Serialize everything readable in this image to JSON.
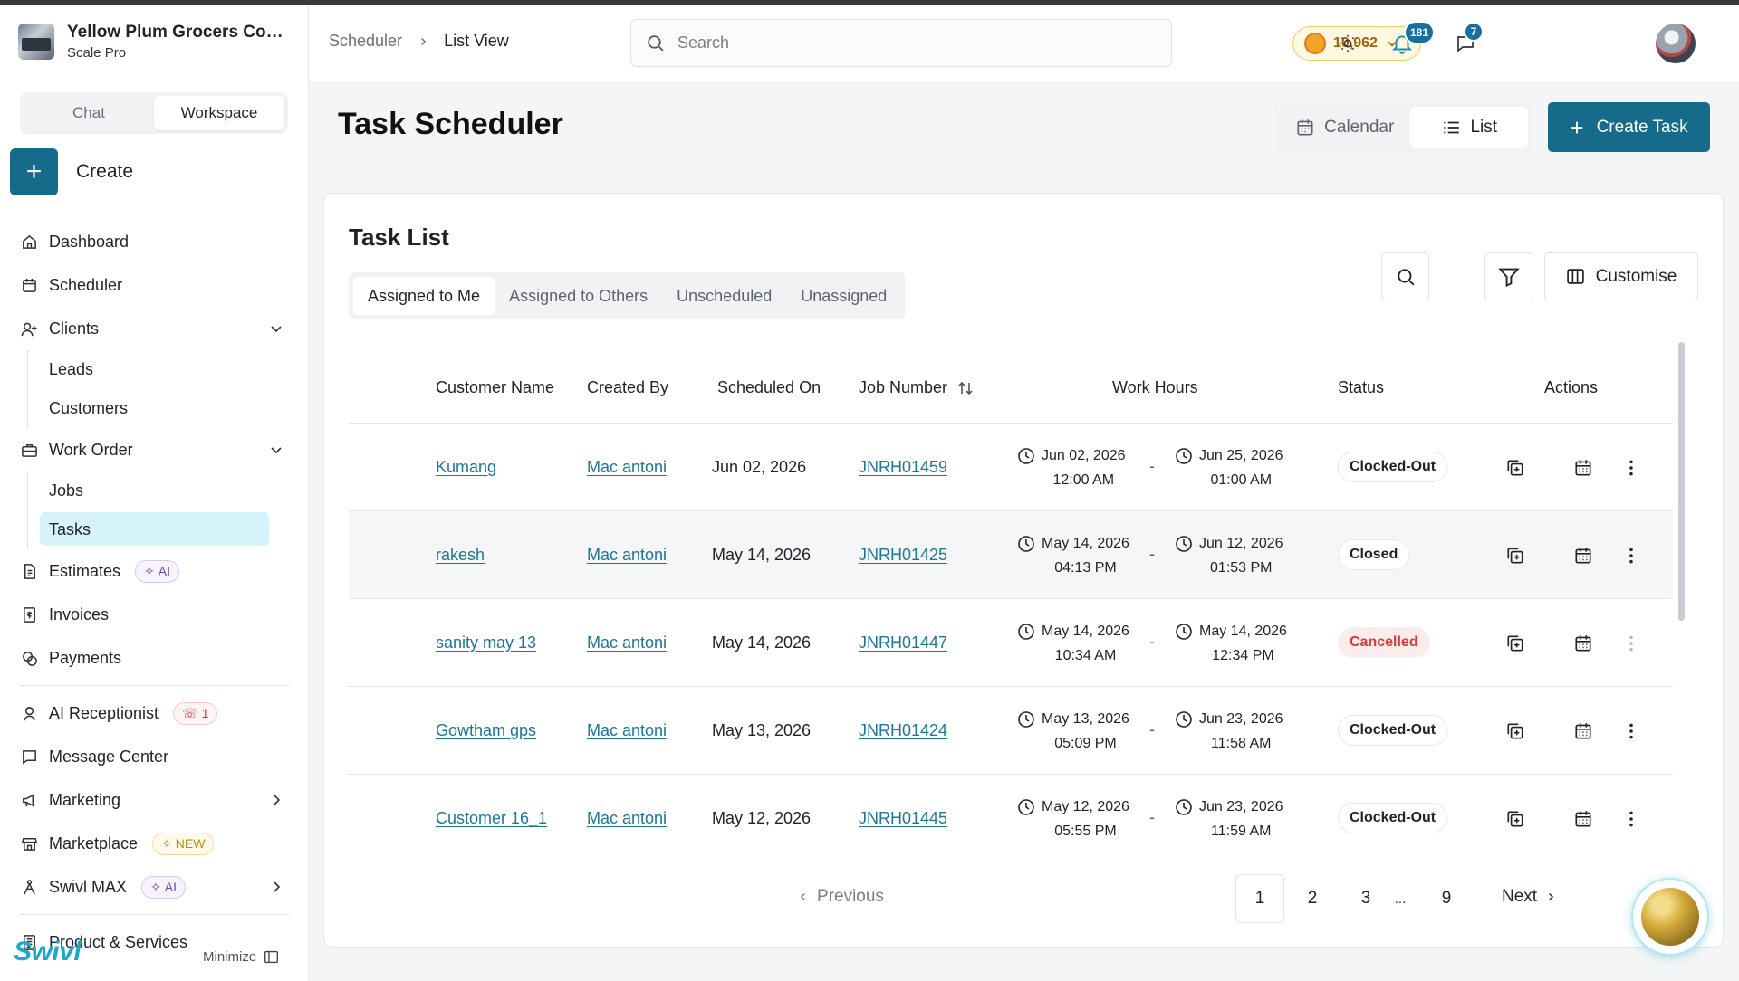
{
  "org": {
    "name": "Yellow Plum Grocers Com...",
    "plan": "Scale Pro"
  },
  "mode_toggle": {
    "chat": "Chat",
    "workspace": "Workspace"
  },
  "create": {
    "label": "Create"
  },
  "nav": {
    "dashboard": "Dashboard",
    "scheduler": "Scheduler",
    "clients": "Clients",
    "leads": "Leads",
    "customers": "Customers",
    "work_order": "Work Order",
    "jobs": "Jobs",
    "tasks": "Tasks",
    "estimates": "Estimates",
    "estimates_badge": "AI",
    "invoices": "Invoices",
    "payments": "Payments",
    "ai_receptionist": "AI Receptionist",
    "ai_receptionist_badge": "1",
    "message_center": "Message Center",
    "marketing": "Marketing",
    "marketplace": "Marketplace",
    "marketplace_badge": "NEW",
    "swivl_max": "Swivl MAX",
    "swivl_max_badge": "AI",
    "product_services": "Product & Services"
  },
  "brand": {
    "logo": "Swivl",
    "minimize": "Minimize"
  },
  "header": {
    "breadcrumb_root": "Scheduler",
    "breadcrumb_current": "List View",
    "search_placeholder": "Search",
    "coins": "10,962",
    "notifications_count": "181",
    "messages_count": "7"
  },
  "page": {
    "title": "Task Scheduler",
    "view_calendar": "Calendar",
    "view_list": "List",
    "create_task": "Create Task"
  },
  "task_list": {
    "title": "Task List",
    "tabs": [
      "Assigned to Me",
      "Assigned to Others",
      "Unscheduled",
      "Unassigned"
    ],
    "customise": "Customise",
    "columns": {
      "customer_name": "Customer Name",
      "created_by": "Created By",
      "scheduled_on": "Scheduled On",
      "job_number": "Job Number",
      "work_hours": "Work Hours",
      "status": "Status",
      "actions": "Actions"
    },
    "rows": [
      {
        "customer": "Kumang",
        "created_by": "Mac antoni",
        "scheduled_on": "Jun 02, 2026",
        "job_number": "JNRH01459",
        "start_date": "Jun 02, 2026",
        "start_time": "12:00 AM",
        "end_date": "Jun 25, 2026",
        "end_time": "01:00 AM",
        "status": "Clocked-Out"
      },
      {
        "customer": "rakesh",
        "created_by": "Mac antoni",
        "scheduled_on": "May 14, 2026",
        "job_number": "JNRH01425",
        "start_date": "May 14, 2026",
        "start_time": "04:13 PM",
        "end_date": "Jun 12, 2026",
        "end_time": "01:53 PM",
        "status": "Closed"
      },
      {
        "customer": "sanity may 13",
        "created_by": "Mac antoni",
        "scheduled_on": "May 14, 2026",
        "job_number": "JNRH01447",
        "start_date": "May 14, 2026",
        "start_time": "10:34 AM",
        "end_date": "May 14, 2026",
        "end_time": "12:34 PM",
        "status": "Cancelled"
      },
      {
        "customer": "Gowtham gps",
        "created_by": "Mac antoni",
        "scheduled_on": "May 13, 2026",
        "job_number": "JNRH01424",
        "start_date": "May 13, 2026",
        "start_time": "05:09 PM",
        "end_date": "Jun 23, 2026",
        "end_time": "11:58 AM",
        "status": "Clocked-Out"
      },
      {
        "customer": "Customer 16_1",
        "created_by": "Mac antoni",
        "scheduled_on": "May 12, 2026",
        "job_number": "JNRH01445",
        "start_date": "May 12, 2026",
        "start_time": "05:55 PM",
        "end_date": "Jun 23, 2026",
        "end_time": "11:59 AM",
        "status": "Clocked-Out"
      }
    ],
    "dash": "-",
    "pagination": {
      "previous": "Previous",
      "pages": [
        "1",
        "2",
        "3",
        "...",
        "9"
      ],
      "next": "Next",
      "current": "1"
    }
  },
  "colors": {
    "primary": "#166b8a",
    "link": "#1d7796",
    "selected_nav": "#d6f3fb",
    "cancelled": "#d63a3a"
  }
}
